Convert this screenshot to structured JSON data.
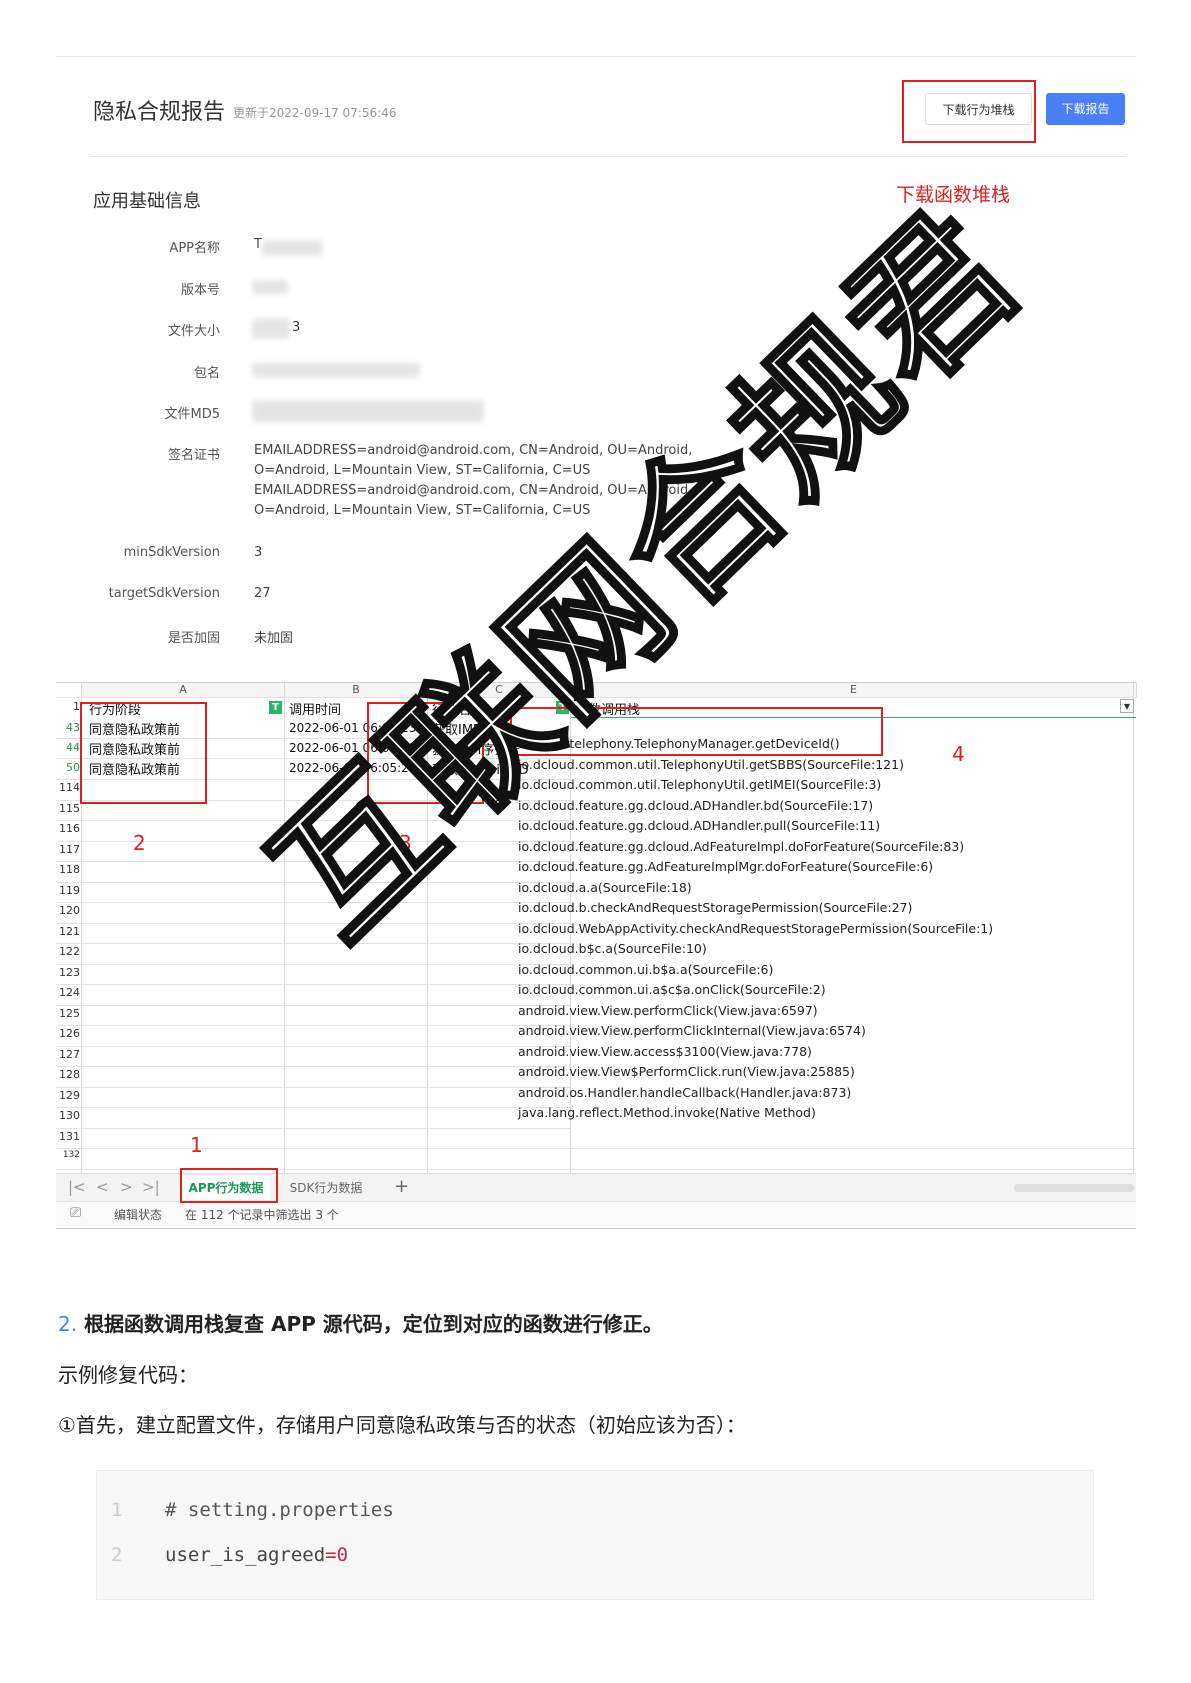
{
  "report": {
    "title": "隐私合规报告",
    "updated": "更新于2022-09-17 07:56:46",
    "download_stack_button": "下载行为堆栈",
    "download_report_button": "下载报告",
    "annotation_download_stack": "下载函数堆栈"
  },
  "basic_info": {
    "section_title": "应用基础信息",
    "fields": [
      {
        "label": "APP名称",
        "value": "T"
      },
      {
        "label": "版本号",
        "value": ""
      },
      {
        "label": "文件大小",
        "value": "3"
      },
      {
        "label": "包名",
        "value": ""
      },
      {
        "label": "文件MD5",
        "value": ""
      },
      {
        "label": "签名证书",
        "value": ""
      },
      {
        "label": "minSdkVersion",
        "value": "3"
      },
      {
        "label": "targetSdkVersion",
        "value": "27"
      },
      {
        "label": "是否加固",
        "value": "未加固"
      }
    ],
    "certificate_lines": [
      "EMAILADDRESS=android@android.com, CN=Android, OU=Android,",
      "O=Android, L=Mountain View, ST=California, C=US",
      "EMAILADDRESS=android@android.com, CN=Android, OU=Android,",
      "O=Android, L=Mountain View, ST=California, C=US"
    ]
  },
  "spreadsheet": {
    "columns": [
      "A",
      "B",
      "C",
      "E"
    ],
    "headers": {
      "stage": "行为阶段",
      "time": "调用时间",
      "action": "行为名称",
      "stack": "函数调用栈"
    },
    "rows": [
      {
        "num": "43",
        "stage": "同意隐私政策前",
        "time": "2022-06-01 06:05:23",
        "action": "获取IMEI"
      },
      {
        "num": "44",
        "stage": "同意隐私政策前",
        "time": "2022-06-01 06:05:23",
        "action": "获取SIM序列号"
      },
      {
        "num": "50",
        "stage": "同意隐私政策前",
        "time": "2022-06-01 06:05:23",
        "action": "获取Android_ID"
      }
    ],
    "empty_row_nums": [
      "114",
      "115",
      "116",
      "117",
      "118",
      "119",
      "120",
      "121",
      "122",
      "123",
      "124",
      "125",
      "126",
      "127",
      "128",
      "129",
      "130",
      "131",
      "132"
    ],
    "call_stack": [
      "android.telephony.TelephonyManager.getDeviceId()",
      "io.dcloud.common.util.TelephonyUtil.getSBBS(SourceFile:121)",
      "io.dcloud.common.util.TelephonyUtil.getIMEI(SourceFile:3)",
      "io.dcloud.feature.gg.dcloud.ADHandler.bd(SourceFile:17)",
      "io.dcloud.feature.gg.dcloud.ADHandler.pull(SourceFile:11)",
      "io.dcloud.feature.gg.dcloud.AdFeatureImpl.doForFeature(SourceFile:83)",
      "io.dcloud.feature.gg.AdFeatureImplMgr.doForFeature(SourceFile:6)",
      "io.dcloud.a.a(SourceFile:18)",
      "io.dcloud.b.checkAndRequestStoragePermission(SourceFile:27)",
      "io.dcloud.WebAppActivity.checkAndRequestStoragePermission(SourceFile:1)",
      "io.dcloud.b$c.a(SourceFile:10)",
      "io.dcloud.common.ui.b$a.a(SourceFile:6)",
      "io.dcloud.common.ui.a$c$a.onClick(SourceFile:2)",
      "android.view.View.performClick(View.java:6597)",
      "android.view.View.performClickInternal(View.java:6574)",
      "android.view.View.access$3100(View.java:778)",
      "android.view.View$PerformClick.run(View.java:25885)",
      "android.os.Handler.handleCallback(Handler.java:873)",
      "java.lang.reflect.Method.invoke(Native Method)"
    ],
    "tabs": [
      "APP行为数据",
      "SDK行为数据"
    ],
    "status_mode": "编辑状态",
    "status_filter": "在 112 个记录中筛选出 3 个",
    "markers": [
      "1",
      "2",
      "3",
      "4"
    ]
  },
  "watermark": "互联网合规君",
  "instructions": {
    "step_number": "2.",
    "step_text": "根据函数调用栈复查 APP 源代码，定位到对应的函数进行修正。",
    "example_label": "示例修复代码：",
    "first_step": "①首先，建立配置文件，存储用户同意隐私政策与否的状态（初始应该为否）："
  },
  "code": {
    "lines": [
      {
        "num": "1",
        "text": "# setting.properties"
      },
      {
        "num": "2",
        "key": "user_is_agreed",
        "eq": "=",
        "val": "0"
      }
    ]
  },
  "colors": {
    "accent_blue": "#4a7ff6",
    "annotation_red": "#e02020",
    "filter_green": "#2db46b"
  }
}
